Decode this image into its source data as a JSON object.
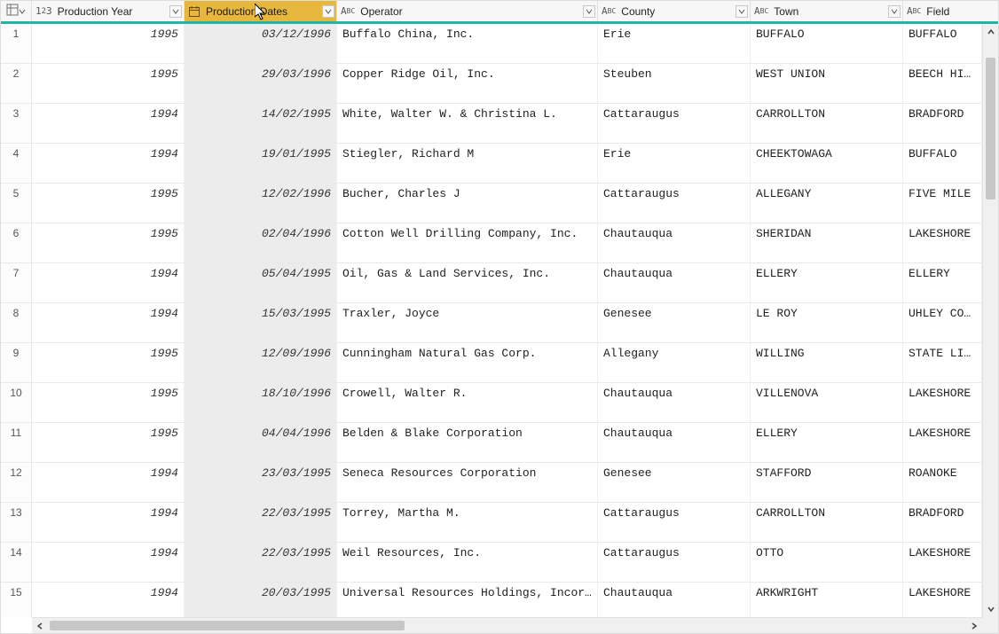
{
  "columns": [
    {
      "key": "production_year",
      "label": "Production Year",
      "type": "int"
    },
    {
      "key": "production_dates",
      "label": "Production Dates",
      "type": "date",
      "selected": true
    },
    {
      "key": "operator",
      "label": "Operator",
      "type": "text"
    },
    {
      "key": "county",
      "label": "County",
      "type": "text"
    },
    {
      "key": "town",
      "label": "Town",
      "type": "text"
    },
    {
      "key": "field",
      "label": "Field",
      "type": "text"
    }
  ],
  "rows": [
    {
      "n": 1,
      "production_year": "1995",
      "production_dates": "03/12/1996",
      "operator": "Buffalo China, Inc.",
      "county": "Erie",
      "town": "BUFFALO",
      "field": "BUFFALO"
    },
    {
      "n": 2,
      "production_year": "1995",
      "production_dates": "29/03/1996",
      "operator": "Copper Ridge Oil, Inc.",
      "county": "Steuben",
      "town": "WEST UNION",
      "field": "BEECH HILL"
    },
    {
      "n": 3,
      "production_year": "1994",
      "production_dates": "14/02/1995",
      "operator": "White, Walter W. & Christina L.",
      "county": "Cattaraugus",
      "town": "CARROLLTON",
      "field": "BRADFORD"
    },
    {
      "n": 4,
      "production_year": "1994",
      "production_dates": "19/01/1995",
      "operator": "Stiegler, Richard M",
      "county": "Erie",
      "town": "CHEEKTOWAGA",
      "field": "BUFFALO"
    },
    {
      "n": 5,
      "production_year": "1995",
      "production_dates": "12/02/1996",
      "operator": "Bucher, Charles J",
      "county": "Cattaraugus",
      "town": "ALLEGANY",
      "field": "FIVE MILE"
    },
    {
      "n": 6,
      "production_year": "1995",
      "production_dates": "02/04/1996",
      "operator": "Cotton Well Drilling Company,  Inc.",
      "county": "Chautauqua",
      "town": "SHERIDAN",
      "field": "LAKESHORE"
    },
    {
      "n": 7,
      "production_year": "1994",
      "production_dates": "05/04/1995",
      "operator": "Oil, Gas & Land Services, Inc.",
      "county": "Chautauqua",
      "town": "ELLERY",
      "field": "ELLERY"
    },
    {
      "n": 8,
      "production_year": "1994",
      "production_dates": "15/03/1995",
      "operator": "Traxler, Joyce",
      "county": "Genesee",
      "town": "LE ROY",
      "field": "UHLEY CORN"
    },
    {
      "n": 9,
      "production_year": "1995",
      "production_dates": "12/09/1996",
      "operator": "Cunningham Natural Gas Corp.",
      "county": "Allegany",
      "town": "WILLING",
      "field": "STATE LINE"
    },
    {
      "n": 10,
      "production_year": "1995",
      "production_dates": "18/10/1996",
      "operator": "Crowell, Walter R.",
      "county": "Chautauqua",
      "town": "VILLENOVA",
      "field": "LAKESHORE"
    },
    {
      "n": 11,
      "production_year": "1995",
      "production_dates": "04/04/1996",
      "operator": "Belden & Blake Corporation",
      "county": "Chautauqua",
      "town": "ELLERY",
      "field": "LAKESHORE"
    },
    {
      "n": 12,
      "production_year": "1994",
      "production_dates": "23/03/1995",
      "operator": "Seneca Resources Corporation",
      "county": "Genesee",
      "town": "STAFFORD",
      "field": "ROANOKE"
    },
    {
      "n": 13,
      "production_year": "1994",
      "production_dates": "22/03/1995",
      "operator": "Torrey, Martha M.",
      "county": "Cattaraugus",
      "town": "CARROLLTON",
      "field": "BRADFORD"
    },
    {
      "n": 14,
      "production_year": "1994",
      "production_dates": "22/03/1995",
      "operator": "Weil Resources, Inc.",
      "county": "Cattaraugus",
      "town": "OTTO",
      "field": "LAKESHORE"
    },
    {
      "n": 15,
      "production_year": "1994",
      "production_dates": "20/03/1995",
      "operator": "Universal Resources Holdings, Incorp…",
      "county": "Chautauqua",
      "town": "ARKWRIGHT",
      "field": "LAKESHORE"
    }
  ]
}
